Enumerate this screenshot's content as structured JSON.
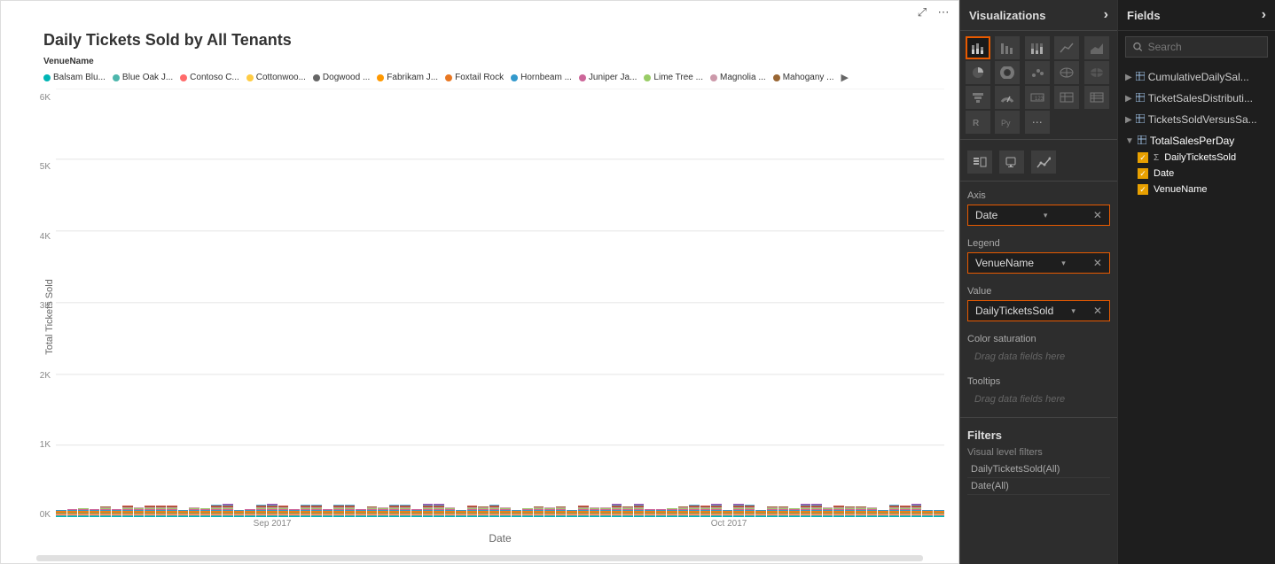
{
  "chart": {
    "title": "Daily Tickets Sold by All Tenants",
    "x_axis_title": "Date",
    "y_axis_title": "Total Tickets Sold",
    "y_ticks": [
      "6K",
      "5K",
      "4K",
      "3K",
      "2K",
      "1K",
      "0K"
    ],
    "x_ticks": [
      "Sep 2017",
      "Oct 2017"
    ],
    "legend_field": "VenueName",
    "legend_items": [
      {
        "label": "Balsam Blu...",
        "color": "#00b5b5"
      },
      {
        "label": "Blue Oak J...",
        "color": "#4db6ac"
      },
      {
        "label": "Contoso C...",
        "color": "#ff6b6b"
      },
      {
        "label": "Cottonwoo...",
        "color": "#ffcc44"
      },
      {
        "label": "Dogwood ...",
        "color": "#666666"
      },
      {
        "label": "Fabrikam J...",
        "color": "#ff9900"
      },
      {
        "label": "Foxtail Rock",
        "color": "#e87722"
      },
      {
        "label": "Hornbeam ...",
        "color": "#3399cc"
      },
      {
        "label": "Juniper Ja...",
        "color": "#cc6699"
      },
      {
        "label": "Lime Tree ...",
        "color": "#99cc66"
      },
      {
        "label": "Magnolia ...",
        "color": "#cc99aa"
      },
      {
        "label": "Mahogany ...",
        "color": "#996633"
      }
    ],
    "legend_more": "▶"
  },
  "toolbar": {
    "focus_icon": "⤢",
    "more_icon": "⋯"
  },
  "visualizations": {
    "header": "Visualizations",
    "header_chevron": "›",
    "active_viz": "stacked-bar",
    "format_icons": [
      "🖌",
      "🔧",
      "📊"
    ],
    "axis_label": "Axis",
    "axis_value": "Date",
    "legend_label": "Legend",
    "legend_value": "VenueName",
    "value_label": "Value",
    "value_value": "DailyTicketsSold",
    "color_saturation_label": "Color saturation",
    "drag_hint": "Drag data fields here",
    "tooltips_label": "Tooltips",
    "filters_label": "Filters",
    "visual_level_label": "Visual level filters",
    "filter_items": [
      "DailyTicketsSold(All)",
      "Date(All)"
    ]
  },
  "fields": {
    "header": "Fields",
    "header_chevron": "›",
    "search_placeholder": "Search",
    "groups": [
      {
        "name": "CumulativeDailySal...",
        "expanded": false,
        "icon": "table",
        "items": []
      },
      {
        "name": "TicketSalesDistributi...",
        "expanded": false,
        "icon": "table",
        "items": []
      },
      {
        "name": "TicketsSoldVersusSa...",
        "expanded": false,
        "icon": "table",
        "items": []
      },
      {
        "name": "TotalSalesPerDay",
        "expanded": true,
        "icon": "table",
        "items": [
          {
            "label": "DailyTicketsSold",
            "checked": true,
            "type": "sigma"
          },
          {
            "label": "Date",
            "checked": true,
            "type": "field"
          },
          {
            "label": "VenueName",
            "checked": true,
            "type": "field"
          }
        ]
      }
    ]
  }
}
